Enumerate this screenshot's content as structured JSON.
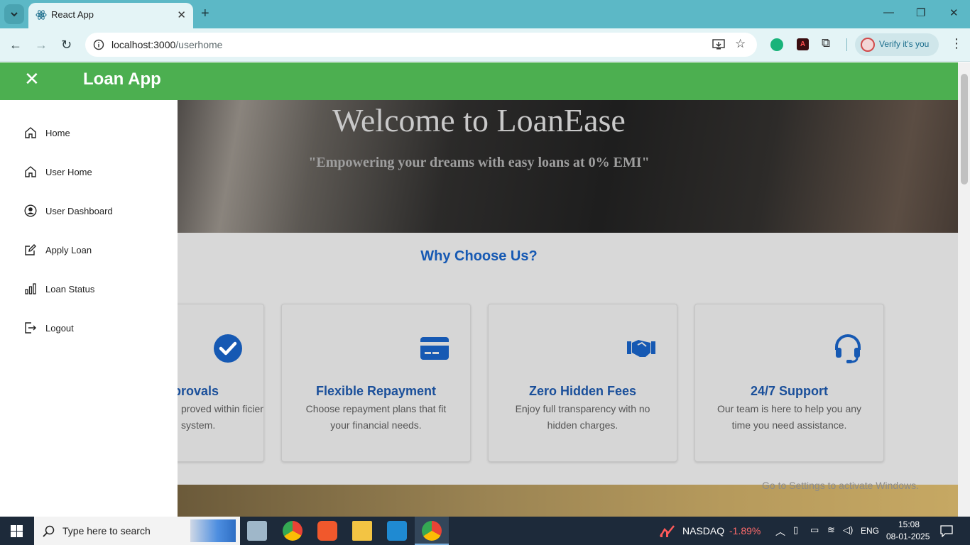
{
  "browser": {
    "tab_title": "React App",
    "url_host": "localhost:3000",
    "url_path": "/userhome",
    "verify_label": "Verify it's you"
  },
  "app": {
    "title": "Loan App"
  },
  "sidebar": {
    "items": [
      {
        "label": "Home",
        "icon": "home-icon"
      },
      {
        "label": "User Home",
        "icon": "home-icon"
      },
      {
        "label": "User Dashboard",
        "icon": "user-circle-icon"
      },
      {
        "label": "Apply Loan",
        "icon": "edit-icon"
      },
      {
        "label": "Loan Status",
        "icon": "bar-chart-icon"
      },
      {
        "label": "Logout",
        "icon": "logout-icon"
      }
    ]
  },
  "hero": {
    "title": "Welcome to LoanEase",
    "subtitle": "\"Empowering your dreams with easy loans at 0% EMI\""
  },
  "why": {
    "title": "Why Choose Us?",
    "cards": [
      {
        "title": "provals",
        "desc": "proved within ficient system.",
        "icon": "check-circle-icon"
      },
      {
        "title": "Flexible Repayment",
        "desc": "Choose repayment plans that fit your financial needs.",
        "icon": "credit-card-icon"
      },
      {
        "title": "Zero Hidden Fees",
        "desc": "Enjoy full transparency with no hidden charges.",
        "icon": "handshake-icon"
      },
      {
        "title": "24/7 Support",
        "desc": "Our team is here to help you any time you need assistance.",
        "icon": "headset-icon"
      }
    ]
  },
  "watermark": "Go to Settings to activate Windows.",
  "taskbar": {
    "search_placeholder": "Type here to search",
    "stock_name": "NASDAQ",
    "stock_change": "-1.89%",
    "lang": "ENG",
    "time": "15:08",
    "date": "08-01-2025"
  },
  "colors": {
    "header": "#4caf50",
    "accent_blue": "#1659b3",
    "stock_down": "#ff6b6b"
  }
}
